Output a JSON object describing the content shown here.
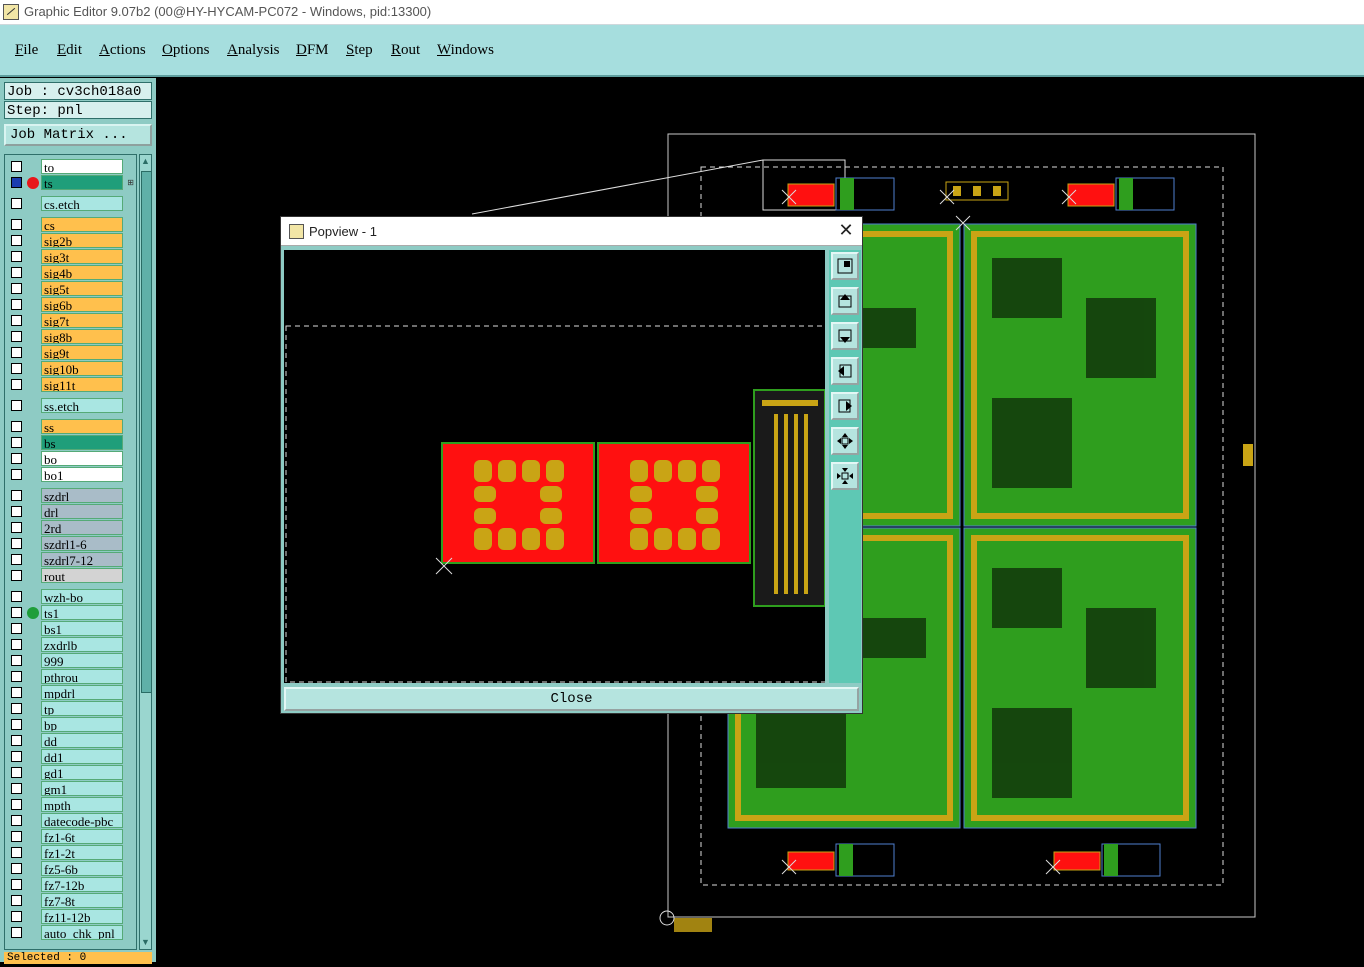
{
  "window": {
    "title": "Graphic Editor 9.07b2 (00@HY-HYCAM-PC072 - Windows, pid:13300)",
    "icon": "graphic-editor-icon"
  },
  "menu": [
    "File",
    "Edit",
    "Actions",
    "Options",
    "Analysis",
    "DFM",
    "Step",
    "Rout",
    "Windows"
  ],
  "info": {
    "job": "Job : cv3ch018a0",
    "step": "Step: pnl"
  },
  "job_matrix_label": "Job Matrix ...",
  "layers": [
    {
      "name": "to",
      "color": "#ffffff"
    },
    {
      "name": "ts",
      "color": "#1f9e7a",
      "active": true,
      "dot": "#e8161a",
      "marker": "⊞"
    },
    {
      "name": "cs.etch",
      "color": "#a9e6e2",
      "gap": true
    },
    {
      "name": "cs",
      "color": "#ffc04d",
      "gap": true
    },
    {
      "name": "sig2b",
      "color": "#ffc04d"
    },
    {
      "name": "sig3t",
      "color": "#ffc04d"
    },
    {
      "name": "sig4b",
      "color": "#ffc04d"
    },
    {
      "name": "sig5t",
      "color": "#ffc04d"
    },
    {
      "name": "sig6b",
      "color": "#ffc04d"
    },
    {
      "name": "sig7t",
      "color": "#ffc04d"
    },
    {
      "name": "sig8b",
      "color": "#ffc04d"
    },
    {
      "name": "sig9t",
      "color": "#ffc04d"
    },
    {
      "name": "sig10b",
      "color": "#ffc04d"
    },
    {
      "name": "sig11t",
      "color": "#ffc04d"
    },
    {
      "name": "ss.etch",
      "color": "#a9e6e2",
      "gap": true
    },
    {
      "name": "ss",
      "color": "#ffc04d",
      "gap": true
    },
    {
      "name": "bs",
      "color": "#1f9e7a"
    },
    {
      "name": "bo",
      "color": "#ffffff"
    },
    {
      "name": "bo1",
      "color": "#ffffff"
    },
    {
      "name": "szdrl",
      "color": "#a9bcc8",
      "gap": true
    },
    {
      "name": "drl",
      "color": "#a9bcc8"
    },
    {
      "name": "2rd",
      "color": "#a9bcc8"
    },
    {
      "name": "szdrl1-6",
      "color": "#a9bcc8"
    },
    {
      "name": "szdrl7-12",
      "color": "#a9bcc8"
    },
    {
      "name": "rout",
      "color": "#d3d3d3"
    },
    {
      "name": "wzh-bo",
      "color": "#a9e6e2",
      "gap": true
    },
    {
      "name": "ts1",
      "color": "#a9e6e2",
      "dot": "#1f9e3a"
    },
    {
      "name": "bs1",
      "color": "#a9e6e2"
    },
    {
      "name": "zxdrlb",
      "color": "#a9e6e2"
    },
    {
      "name": "999",
      "color": "#a9e6e2"
    },
    {
      "name": "pthrou",
      "color": "#a9e6e2"
    },
    {
      "name": "mpdrl",
      "color": "#a9e6e2"
    },
    {
      "name": "tp",
      "color": "#a9e6e2"
    },
    {
      "name": "bp",
      "color": "#a9e6e2"
    },
    {
      "name": "dd",
      "color": "#a9e6e2"
    },
    {
      "name": "dd1",
      "color": "#a9e6e2"
    },
    {
      "name": "gd1",
      "color": "#a9e6e2"
    },
    {
      "name": "gm1",
      "color": "#a9e6e2"
    },
    {
      "name": "mpth",
      "color": "#a9e6e2"
    },
    {
      "name": "datecode-pbc",
      "color": "#a9e6e2"
    },
    {
      "name": "fz1-6t",
      "color": "#a9e6e2"
    },
    {
      "name": "fz1-2t",
      "color": "#a9e6e2"
    },
    {
      "name": "fz5-6b",
      "color": "#a9e6e2"
    },
    {
      "name": "fz7-12b",
      "color": "#a9e6e2"
    },
    {
      "name": "fz7-8t",
      "color": "#a9e6e2"
    },
    {
      "name": "fz11-12b",
      "color": "#a9e6e2"
    },
    {
      "name": "auto_chk_pnl",
      "color": "#a9e6e2"
    }
  ],
  "status": {
    "selected": "Selected : 0"
  },
  "popview": {
    "title": "Popview - 1",
    "close_label": "Close",
    "tools": [
      "zoom-window-icon",
      "pan-up-icon",
      "pan-down-icon",
      "pan-left-icon",
      "pan-right-icon",
      "zoom-in-icon",
      "zoom-out-icon"
    ]
  },
  "colors": {
    "menubar": "#a6dede",
    "panel": "#8ecbc4",
    "board_green": "#2f9e1e",
    "copper": "#c9a415",
    "pad_red": "#ff1010"
  }
}
